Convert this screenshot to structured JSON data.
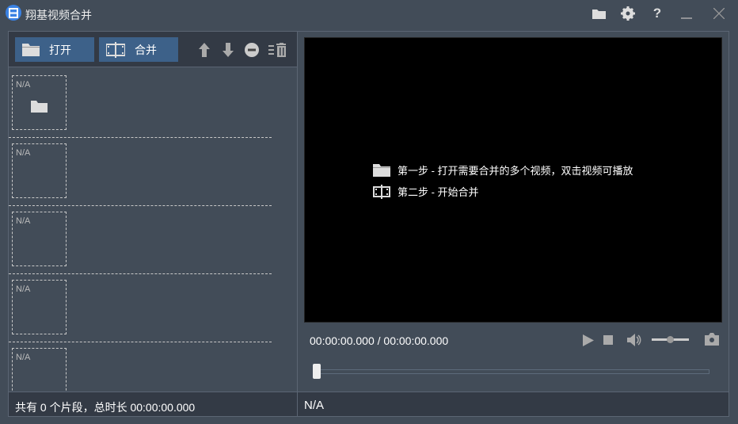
{
  "window": {
    "title": "翔基视频合并"
  },
  "titlebar_icons": [
    "folder-icon",
    "gear-icon",
    "help-icon",
    "minimize-icon",
    "close-icon"
  ],
  "toolbar": {
    "open_label": "打开",
    "merge_label": "合并"
  },
  "list": {
    "items": [
      {
        "label": "N/A"
      },
      {
        "label": "N/A"
      },
      {
        "label": "N/A"
      },
      {
        "label": "N/A"
      },
      {
        "label": "N/A"
      }
    ]
  },
  "left_status": "共有 0 个片段，总时长 00:00:00.000",
  "player": {
    "step1": "第一步 - 打开需要合并的多个视频，双击视频可播放",
    "step2": "第二步 - 开始合并",
    "time": "00:00:00.000 / 00:00:00.000",
    "progress": 0,
    "volume": 0.5
  },
  "right_status": "N/A"
}
